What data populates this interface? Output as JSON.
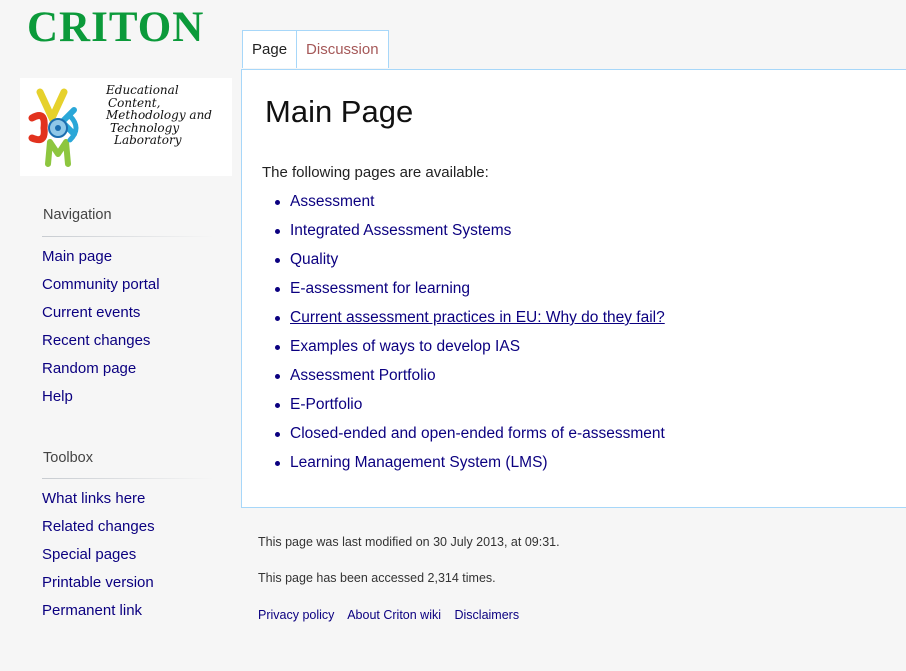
{
  "logo": {
    "title": "CRITON",
    "subtitle_lines": [
      "Educational",
      "Content,",
      "Methodology and",
      "Technology",
      "Laboratory"
    ]
  },
  "tabs": [
    {
      "label": "Page"
    },
    {
      "label": "Discussion"
    }
  ],
  "main": {
    "title": "Main Page",
    "intro": "The following pages are available:",
    "pages": [
      "Assessment",
      "Integrated Assessment Systems",
      "Quality",
      "E-assessment for learning",
      "Current assessment practices in EU: Why do they fail?",
      "Examples of ways to develop IAS",
      "Assessment Portfolio",
      "E-Portfolio",
      "Closed-ended and open-ended forms of e-assessment",
      "Learning Management System (LMS)"
    ]
  },
  "sidebar": {
    "navigation": {
      "heading": "Navigation",
      "items": [
        "Main page",
        "Community portal",
        "Current events",
        "Recent changes",
        "Random page",
        "Help"
      ]
    },
    "toolbox": {
      "heading": "Toolbox",
      "items": [
        "What links here",
        "Related changes",
        "Special pages",
        "Printable version",
        "Permanent link"
      ]
    }
  },
  "footer": {
    "last_modified": "This page was last modified on 30 July 2013, at 09:31.",
    "accessed": "This page has been accessed 2,314 times.",
    "links": [
      "Privacy policy",
      "About Criton wiki",
      "Disclaimers"
    ]
  },
  "colors": {
    "logo_green": "#0b9a3a",
    "link": "#0b0080",
    "tab_border": "#a7d7f9",
    "discussion_tab": "#a55858"
  }
}
